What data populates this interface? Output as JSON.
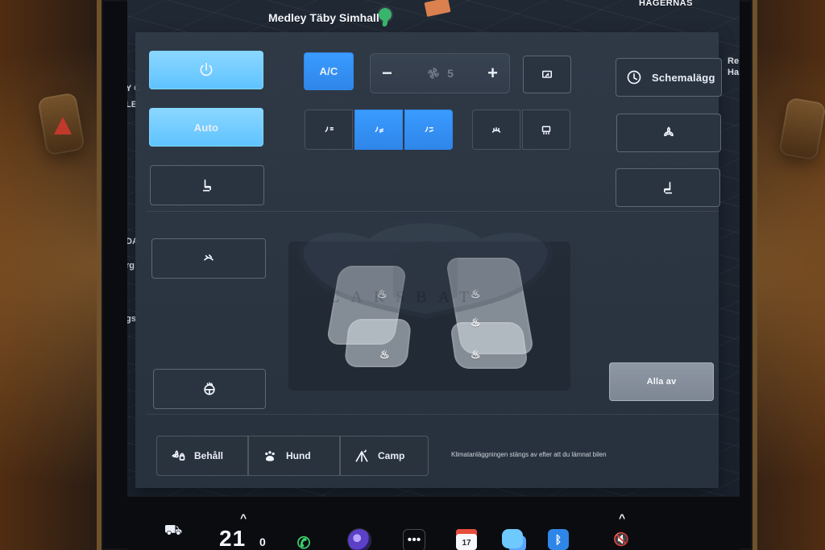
{
  "map": {
    "label_top": "Medley Täby Simhall",
    "label_right": "HAGERNAS",
    "left_labels": [
      "Re",
      "Ha",
      "Y C",
      "LE",
      "DA",
      "rg",
      "gs"
    ]
  },
  "climate": {
    "buttons": {
      "auto_label": "Auto",
      "ac_label": "A/C",
      "schedule_label": "Schemalägg",
      "all_off_label": "Alla av"
    },
    "fan": {
      "minus": "−",
      "plus": "+",
      "level": "5"
    },
    "modes": [
      {
        "key": "keep",
        "label": "Behåll"
      },
      {
        "key": "dog",
        "label": "Hund"
      },
      {
        "key": "camp",
        "label": "Camp"
      }
    ],
    "message": "Klimatanläggningen stängs av efter att du lämnat bilen"
  },
  "watermark": {
    "text": "CARSBAT"
  },
  "dock": {
    "temperature": "21",
    "temp_unit": "0",
    "caret_up": "^",
    "calendar_day": "17"
  },
  "colors": {
    "accent_blue": "#2f86e9",
    "accent_cyan": "#7fd6ff",
    "hazard_red": "#c0392b"
  }
}
